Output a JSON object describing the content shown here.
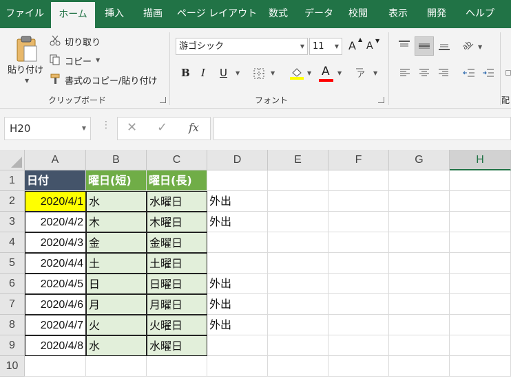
{
  "ribbon_tabs": [
    {
      "label": "ファイル"
    },
    {
      "label": "ホーム"
    },
    {
      "label": "挿入"
    },
    {
      "label": "描画"
    },
    {
      "label": "ページ レイアウト"
    },
    {
      "label": "数式"
    },
    {
      "label": "データ"
    },
    {
      "label": "校閲"
    },
    {
      "label": "表示"
    },
    {
      "label": "開発"
    },
    {
      "label": "ヘルプ"
    }
  ],
  "clipboard": {
    "paste_label": "貼り付け",
    "cut_label": "切り取り",
    "copy_label": "コピー",
    "format_painter_label": "書式のコピー/貼り付け",
    "group_label": "クリップボード"
  },
  "font": {
    "font_name": "游ゴシック",
    "font_size": "11",
    "grow_label": "A",
    "shrink_label": "A",
    "bold_label": "B",
    "italic_label": "I",
    "underline_label": "U",
    "font_color_label": "A",
    "highlight_color": "#ffff00",
    "font_color": "#ff0000",
    "group_label": "フォント"
  },
  "alignment": {
    "group_label_partial": "配"
  },
  "formula_bar": {
    "name_box": "H20",
    "fx_label": "fx",
    "formula": ""
  },
  "sheet": {
    "columns": [
      "A",
      "B",
      "C",
      "D",
      "E",
      "F",
      "G",
      "H"
    ],
    "selected_column": "H",
    "rows": [
      "1",
      "2",
      "3",
      "4",
      "5",
      "6",
      "7",
      "8",
      "9",
      "10"
    ],
    "header_row": [
      "日付",
      "曜日(短)",
      "曜日(長)"
    ],
    "data_rows": [
      {
        "date": "2020/4/1",
        "short": "水",
        "long": "水曜日",
        "note": "外出"
      },
      {
        "date": "2020/4/2",
        "short": "木",
        "long": "木曜日",
        "note": "外出"
      },
      {
        "date": "2020/4/3",
        "short": "金",
        "long": "金曜日",
        "note": ""
      },
      {
        "date": "2020/4/4",
        "short": "土",
        "long": "土曜日",
        "note": ""
      },
      {
        "date": "2020/4/5",
        "short": "日",
        "long": "日曜日",
        "note": "外出"
      },
      {
        "date": "2020/4/6",
        "short": "月",
        "long": "月曜日",
        "note": "外出"
      },
      {
        "date": "2020/4/7",
        "short": "火",
        "long": "火曜日",
        "note": "外出"
      },
      {
        "date": "2020/4/8",
        "short": "水",
        "long": "水曜日",
        "note": ""
      }
    ],
    "colors": {
      "header_dark": "#44546a",
      "header_green": "#70ad47",
      "fill_light_green": "#e2efda",
      "highlight_yellow": "#ffff00",
      "accent": "#217346"
    }
  }
}
